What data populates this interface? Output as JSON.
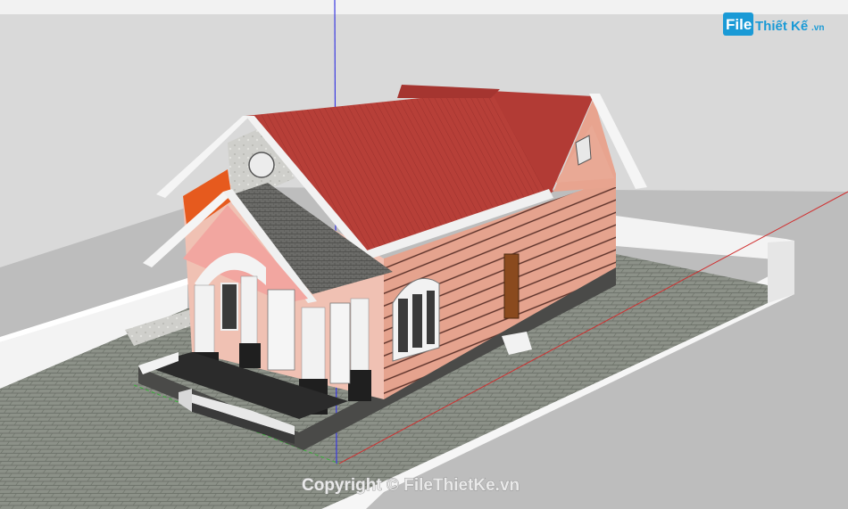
{
  "logo": {
    "file": "File",
    "main": "Thiết Kế",
    "tld": ".vn"
  },
  "watermark": {
    "text": "Copyright © FileThietKe.vn"
  },
  "colors": {
    "sky": "#dadada",
    "ground": "#bdbdbd",
    "wall": "#e4a18d",
    "roof_red": "#b8403a",
    "roof_grey": "#6a6a68",
    "fence": "#f4f4f4",
    "paving": "#8a8f85",
    "axis_blue": "#3a3ae0",
    "axis_red": "#d03030",
    "axis_green": "#3ab03a",
    "logo_blue": "#1a9ad6"
  }
}
